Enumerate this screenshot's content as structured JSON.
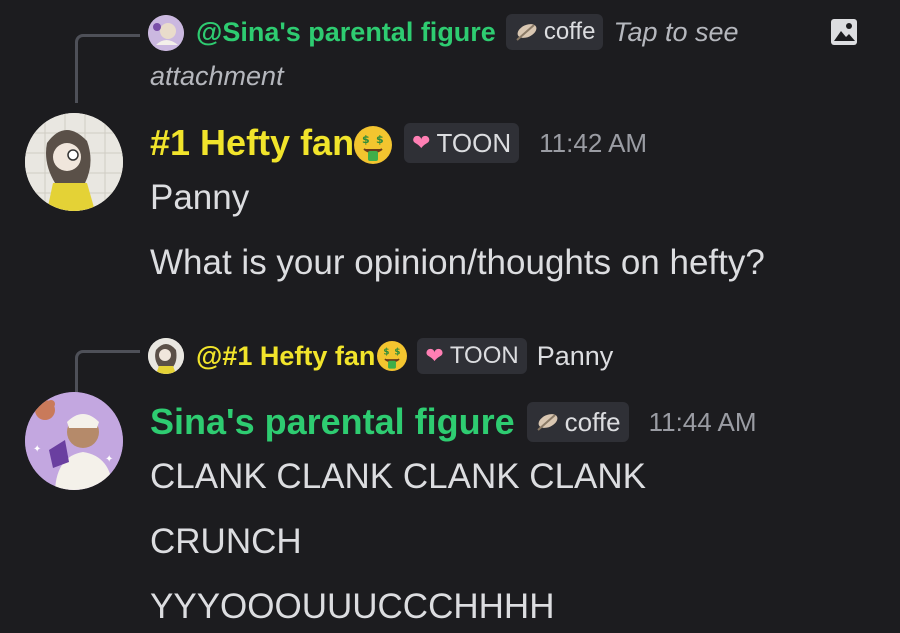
{
  "message1": {
    "reply": {
      "mention": "@Sina's parental figure",
      "tag": "coffe",
      "preview": "Tap to see",
      "preview_cont": "attachment"
    },
    "author": "#1 Hefty fan",
    "tag": "TOON",
    "time": "11:42 AM",
    "lines": [
      "Panny",
      "What is your opinion/thoughts on hefty?"
    ]
  },
  "message2": {
    "reply": {
      "mention": "@#1 Hefty fan",
      "tag": "TOON",
      "preview": "Panny"
    },
    "author": "Sina's parental figure",
    "tag": "coffe",
    "time": "11:44 AM",
    "lines": [
      "CLANK CLANK CLANK CLANK",
      "CRUNCH",
      "YYYOOOUUUCCCHHHH"
    ]
  },
  "icons": {
    "image_attachment": "image-icon",
    "money_emoji": "money-mouth-face-emoji",
    "heart": "pink-heart-icon",
    "feather": "feather-icon"
  },
  "colors": {
    "background": "#1c1c1f",
    "green_name": "#2ecc71",
    "yellow_name": "#f1e42b",
    "tag_bg": "#2f3036"
  }
}
